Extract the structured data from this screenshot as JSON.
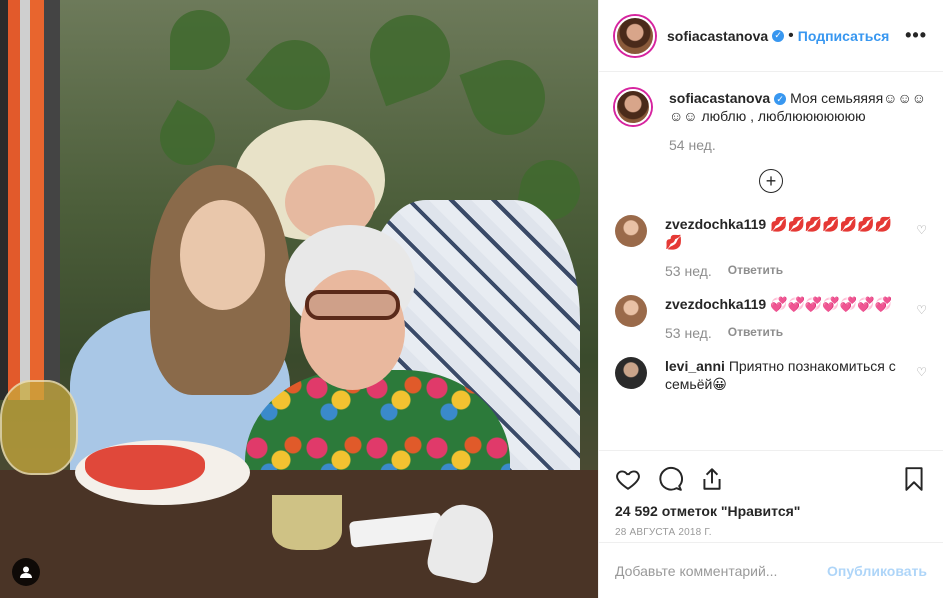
{
  "post": {
    "username": "sofiacastanova",
    "follow_label": "Подписаться",
    "more_label": "•••",
    "caption_text": "Моя семьяяяя☺☺☺☺☺ люблю , люблююююююю",
    "caption_time": "54 нед."
  },
  "comments": [
    {
      "username": "zvezdochka119",
      "text": "💋💋💋💋💋💋💋💋",
      "time": "53 нед.",
      "reply_label": "Ответить"
    },
    {
      "username": "zvezdochka119",
      "text": "💞💞💞💞💞💞💞",
      "time": "53 нед.",
      "reply_label": "Ответить"
    },
    {
      "username": "levi_anni",
      "text": "Приятно познакомиться с семьёй😀"
    }
  ],
  "actions": {
    "likes": "24 592 отметок \"Нравится\"",
    "date": "28 августа 2018 г."
  },
  "composer": {
    "placeholder": "Добавьте комментарий...",
    "publish_label": "Опубликовать"
  },
  "icons": {
    "verified": "verified-badge-icon",
    "load_more": "plus-circle-icon",
    "like": "heart-icon",
    "comment": "comment-bubble-icon",
    "share": "share-icon",
    "save": "bookmark-icon",
    "tag": "user-tag-icon"
  },
  "colors": {
    "accent": "#3897f0",
    "muted": "#8e8e8e",
    "text": "#262626"
  }
}
